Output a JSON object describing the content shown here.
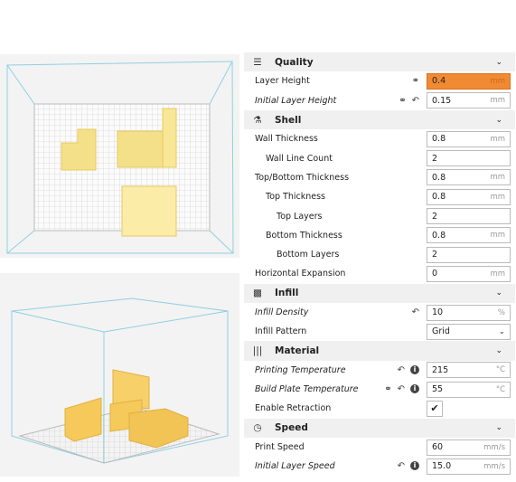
{
  "colors": {
    "highlight": "#f08a33",
    "model": "#f5d76e",
    "grid": "#c8c8c8",
    "frame": "#8fd0e0"
  },
  "sections": [
    {
      "title": "Quality",
      "icon": "quality-icon",
      "items": [
        {
          "label": "Layer Height",
          "value": "0.4",
          "unit": "mm",
          "italic": false,
          "icons": [
            "link-icon"
          ],
          "highlight": true
        },
        {
          "label": "Initial Layer Height",
          "value": "0.15",
          "unit": "mm",
          "italic": true,
          "icons": [
            "link-icon",
            "reset-icon"
          ]
        }
      ]
    },
    {
      "title": "Shell",
      "icon": "shell-icon",
      "items": [
        {
          "label": "Wall Thickness",
          "value": "0.8",
          "unit": "mm"
        },
        {
          "label": "Wall Line Count",
          "value": "2",
          "unit": "",
          "indent": 1
        },
        {
          "label": "Top/Bottom Thickness",
          "value": "0.8",
          "unit": "mm"
        },
        {
          "label": "Top Thickness",
          "value": "0.8",
          "unit": "mm",
          "indent": 1
        },
        {
          "label": "Top Layers",
          "value": "2",
          "unit": "",
          "indent": 2
        },
        {
          "label": "Bottom Thickness",
          "value": "0.8",
          "unit": "mm",
          "indent": 1
        },
        {
          "label": "Bottom Layers",
          "value": "2",
          "unit": "",
          "indent": 2
        },
        {
          "label": "Horizontal Expansion",
          "value": "0",
          "unit": "mm"
        }
      ]
    },
    {
      "title": "Infill",
      "icon": "infill-icon",
      "items": [
        {
          "label": "Infill Density",
          "value": "10",
          "unit": "%",
          "italic": true,
          "icons": [
            "reset-icon"
          ]
        },
        {
          "label": "Infill Pattern",
          "value": "Grid",
          "type": "select"
        }
      ]
    },
    {
      "title": "Material",
      "icon": "material-icon",
      "items": [
        {
          "label": "Printing Temperature",
          "value": "215",
          "unit": "°C",
          "italic": true,
          "icons": [
            "reset-icon",
            "info-icon"
          ]
        },
        {
          "label": "Build Plate Temperature",
          "value": "55",
          "unit": "°C",
          "italic": true,
          "icons": [
            "link-icon",
            "reset-icon",
            "info-icon"
          ]
        },
        {
          "label": "Enable Retraction",
          "type": "checkbox",
          "checked": true
        }
      ]
    },
    {
      "title": "Speed",
      "icon": "speed-icon",
      "items": [
        {
          "label": "Print Speed",
          "value": "60",
          "unit": "mm/s"
        },
        {
          "label": "Initial Layer Speed",
          "value": "15.0",
          "unit": "mm/s",
          "italic": true,
          "icons": [
            "reset-icon",
            "info-icon"
          ]
        }
      ]
    }
  ]
}
